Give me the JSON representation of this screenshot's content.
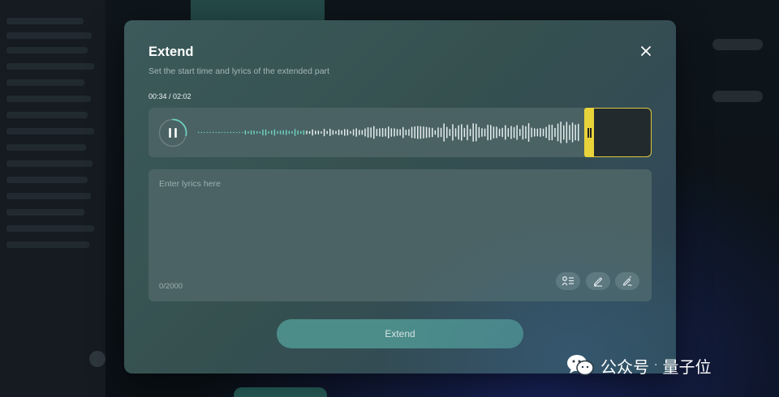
{
  "dialog": {
    "title": "Extend",
    "subtitle": "Set the start time and lyrics of the extended part",
    "close_icon": "close-icon",
    "time_display": "00:34 / 02:02",
    "player": {
      "state": "playing",
      "play_icon": "pause-icon",
      "progress": 0.28,
      "extend_start_fraction": 0.88,
      "accent_color": "#e8d33a",
      "played_color": "#6fd0c0"
    },
    "lyrics": {
      "placeholder": "Enter lyrics here",
      "value": "",
      "counter": "0/2000",
      "tools": [
        {
          "icon": "lyrics-structure-icon"
        },
        {
          "icon": "pencil-icon"
        },
        {
          "icon": "write-icon"
        }
      ]
    },
    "submit_label": "Extend"
  },
  "watermark": {
    "icon": "wechat-icon",
    "text": "公众号",
    "separator": "·",
    "brand": "量子位"
  }
}
